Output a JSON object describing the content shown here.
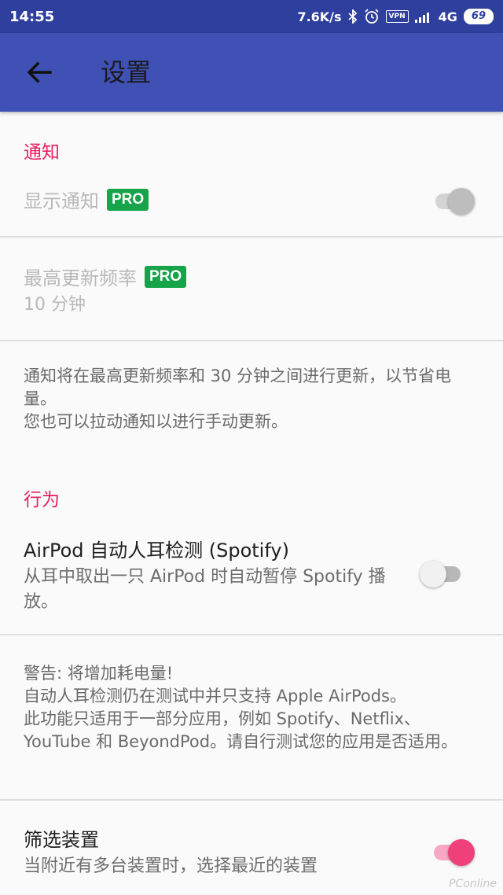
{
  "status_bar": {
    "time": "14:55",
    "net_speed": "7.6K/s",
    "vpn": "VPN",
    "network": "4G",
    "battery": "69"
  },
  "toolbar": {
    "title": "设置"
  },
  "sections": {
    "notification_header": "通知",
    "behavior_header": "行为"
  },
  "prefs": {
    "show_notification": {
      "title": "显示通知",
      "badge": "PRO",
      "enabled": false,
      "checked": true
    },
    "max_update_freq": {
      "title": "最高更新频率",
      "badge": "PRO",
      "summary": "10 分钟"
    },
    "airpod_ear_detect": {
      "title": "AirPod 自动人耳检测 (Spotify)",
      "summary": "从耳中取出一只 AirPod 时自动暂停 Spotify 播放。",
      "checked": false
    },
    "filter_devices": {
      "title": "筛选装置",
      "summary": "当附近有多台装置时，选择最近的装置",
      "checked": true
    }
  },
  "notes": {
    "update_note_line1": "通知将在最高更新频率和 30 分钟之间进行更新，以节省电量。",
    "update_note_line2": "您也可以拉动通知以进行手动更新。",
    "warning_line1": "警告: 将增加耗电量!",
    "warning_line2": "自动人耳检测仍在测试中并只支持 Apple AirPods。",
    "warning_line3": "此功能只适用于一部分应用，例如 Spotify、Netflix、YouTube 和 BeyondPod。请自行测试您的应用是否适用。"
  },
  "watermark": "PConline",
  "colors": {
    "status_bar": "#2f3f9e",
    "toolbar": "#3f51b5",
    "accent": "#e91e63",
    "pro_badge": "#16a34a"
  }
}
